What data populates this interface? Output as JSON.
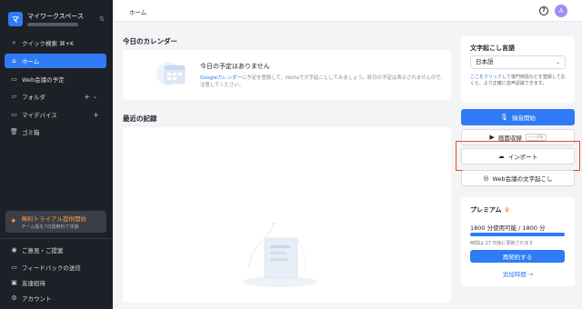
{
  "sidebar": {
    "workspace_logo": "マ",
    "workspace_name": "マイワークスペース",
    "items": [
      {
        "icon": "search-icon",
        "glyph": "⌕",
        "label": "クイック検索 ⌘+K"
      },
      {
        "icon": "home-icon",
        "glyph": "⌂",
        "label": "ホーム"
      },
      {
        "icon": "web-meeting-icon",
        "glyph": "▭",
        "label": "Web会議の予定"
      },
      {
        "icon": "folder-icon",
        "glyph": "▱",
        "label": "フォルダ"
      },
      {
        "icon": "device-icon",
        "glyph": "▭",
        "label": "マイデバイス"
      },
      {
        "icon": "trash-icon",
        "glyph": "🗑",
        "label": "ゴミ箱"
      }
    ],
    "trial": {
      "title": "無料トライアル提供開始",
      "subtitle": "チーム版を7日間無料で体験"
    },
    "footer_items": [
      {
        "icon": "feedback-icon",
        "glyph": "◉",
        "label": "ご意見・ご提案"
      },
      {
        "icon": "feedback-send-icon",
        "glyph": "▭",
        "label": "フィードバックの送信"
      },
      {
        "icon": "invite-icon",
        "glyph": "▣",
        "label": "友達招待"
      },
      {
        "icon": "account-icon",
        "glyph": "⚙",
        "label": "アカウント"
      }
    ]
  },
  "header": {
    "breadcrumb": "ホーム",
    "help_glyph": "?",
    "avatar": "A"
  },
  "calendar": {
    "heading": "今日のカレンダー",
    "empty_title": "今日の予定はありません",
    "link_text": "Googleカレンダー",
    "desc_rest": "に予定を登録して、Nottaで文字起こししてみましょう。終日の予定は表示されませんので、注意してください。"
  },
  "records": {
    "heading": "最近の記録"
  },
  "transcription_lang": {
    "title": "文字起こし言語",
    "selected": "日本語",
    "note_link": "ここをクリック",
    "note_rest": "して専門用語などを登録しておくと、より正確に音声認識できます。"
  },
  "actions": {
    "record": "録音開始",
    "screen_record": "画面収録",
    "beta": "ベータ版",
    "import": "インポート",
    "web_transcribe": "Web会議の文字起こし"
  },
  "premium": {
    "title": "プレミアム",
    "usage": "1800 分使用可能 / 1800 分",
    "usage_fraction": 1.0,
    "renew_note": "時間は 27 日後に更新されます",
    "renew_button": "再契約する",
    "add_time": "追加時間 →"
  },
  "colors": {
    "accent": "#2f7bf5",
    "sidebar_bg": "#1d2026",
    "highlight": "#e04a33",
    "trial": "#ff9a4a"
  }
}
